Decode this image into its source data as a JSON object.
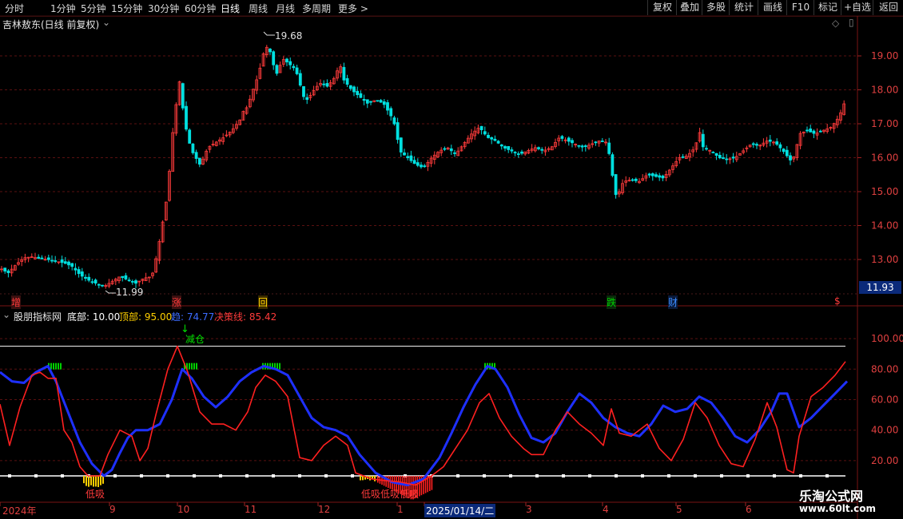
{
  "toolbar": {
    "periods": [
      "分时",
      "1分钟",
      "5分钟",
      "15分钟",
      "30分钟",
      "60分钟",
      "日线",
      "周线",
      "月线",
      "多周期",
      "更多 >"
    ],
    "selected": "日线",
    "right_buttons": [
      "复权",
      "叠加",
      "多股",
      "统计",
      "画线",
      "F10",
      "标记",
      "+自选",
      "返回"
    ]
  },
  "main_panel": {
    "title": "吉林敖东(日线 前复权)",
    "high_label": "19.68",
    "low_label": "11.99",
    "current_price": "11.93",
    "event_markers": [
      {
        "text": "增",
        "color": "#ff3b3b"
      },
      {
        "text": "涨",
        "color": "#ff3b3b"
      },
      {
        "text": "回",
        "color": "#ffd000"
      },
      {
        "text": "跌",
        "color": "#00d000"
      },
      {
        "text": "财",
        "color": "#3c8cff"
      },
      {
        "text": "$",
        "color": "#ff3b3b"
      }
    ]
  },
  "indicator_panel": {
    "name": "股朋指标网",
    "params": [
      {
        "label": "底部: 10.00",
        "color": "#ffffff"
      },
      {
        "label": "顶部: 95.00",
        "color": "#ffd000"
      },
      {
        "label": "趋: 74.77",
        "color": "#3c6cff"
      },
      {
        "label": "决策线: 85.42",
        "color": "#ff3b3b"
      }
    ],
    "annotations": {
      "reduce": "减仓",
      "buy_low_1": "低吸",
      "buy_low_2": "低吸低吸低吸"
    }
  },
  "x_axis": {
    "labels": [
      "2024年",
      "9",
      "10",
      "11",
      "12",
      "1",
      "2025/01/14/二",
      "3",
      "4",
      "5",
      "6"
    ]
  },
  "watermark": {
    "title": "乐淘公式网",
    "url": "www.60lt.com"
  },
  "colors": {
    "up": "#ff3b3b",
    "down": "#00e0e0",
    "trend": "#1e30ff",
    "decision": "#ff2020",
    "grid": "#5a1010"
  },
  "chart_data": [
    {
      "type": "candlestick",
      "title": "吉林敖东(日线 前复权)",
      "y_ticks": [
        13.0,
        14.0,
        15.0,
        16.0,
        17.0,
        18.0,
        19.0
      ],
      "ylim": [
        11.6,
        20.6
      ],
      "approx_close_path": [
        [
          0,
          12.75
        ],
        [
          10,
          12.6
        ],
        [
          20,
          12.85
        ],
        [
          30,
          13.05
        ],
        [
          40,
          13.08
        ],
        [
          50,
          13.02
        ],
        [
          60,
          13.0
        ],
        [
          70,
          12.95
        ],
        [
          80,
          12.9
        ],
        [
          90,
          12.8
        ],
        [
          100,
          12.55
        ],
        [
          110,
          12.4
        ],
        [
          120,
          12.3
        ],
        [
          130,
          12.2
        ],
        [
          140,
          12.35
        ],
        [
          150,
          12.5
        ],
        [
          160,
          12.4
        ],
        [
          170,
          12.3
        ],
        [
          180,
          12.45
        ],
        [
          190,
          12.5
        ],
        [
          195,
          13.0
        ],
        [
          200,
          13.6
        ],
        [
          205,
          14.3
        ],
        [
          210,
          15.0
        ],
        [
          215,
          16.5
        ],
        [
          220,
          17.5
        ],
        [
          225,
          18.3
        ],
        [
          230,
          17.2
        ],
        [
          235,
          16.6
        ],
        [
          240,
          16.2
        ],
        [
          245,
          16.0
        ],
        [
          250,
          15.8
        ],
        [
          255,
          16.0
        ],
        [
          260,
          16.3
        ],
        [
          270,
          16.45
        ],
        [
          280,
          16.6
        ],
        [
          290,
          16.8
        ],
        [
          300,
          17.1
        ],
        [
          305,
          17.4
        ],
        [
          310,
          17.5
        ],
        [
          315,
          17.9
        ],
        [
          320,
          18.2
        ],
        [
          325,
          18.6
        ],
        [
          330,
          19.1
        ],
        [
          335,
          19.3
        ],
        [
          340,
          19.0
        ],
        [
          345,
          18.4
        ],
        [
          350,
          18.7
        ],
        [
          355,
          18.9
        ],
        [
          360,
          18.8
        ],
        [
          365,
          18.7
        ],
        [
          370,
          18.6
        ],
        [
          375,
          18.2
        ],
        [
          380,
          17.8
        ],
        [
          385,
          17.7
        ],
        [
          390,
          17.9
        ],
        [
          400,
          18.2
        ],
        [
          410,
          18.1
        ],
        [
          420,
          18.4
        ],
        [
          425,
          18.8
        ],
        [
          430,
          18.3
        ],
        [
          440,
          18.0
        ],
        [
          450,
          17.8
        ],
        [
          460,
          17.6
        ],
        [
          470,
          17.7
        ],
        [
          480,
          17.6
        ],
        [
          490,
          17.2
        ],
        [
          495,
          16.9
        ],
        [
          500,
          16.2
        ],
        [
          510,
          16.0
        ],
        [
          520,
          15.8
        ],
        [
          530,
          15.7
        ],
        [
          540,
          16.0
        ],
        [
          550,
          16.2
        ],
        [
          560,
          16.3
        ],
        [
          570,
          16.1
        ],
        [
          580,
          16.4
        ],
        [
          590,
          16.7
        ],
        [
          600,
          16.9
        ],
        [
          610,
          16.6
        ],
        [
          620,
          16.5
        ],
        [
          630,
          16.3
        ],
        [
          640,
          16.2
        ],
        [
          650,
          16.1
        ],
        [
          660,
          16.2
        ],
        [
          670,
          16.3
        ],
        [
          680,
          16.2
        ],
        [
          690,
          16.3
        ],
        [
          700,
          16.6
        ],
        [
          710,
          16.5
        ],
        [
          720,
          16.4
        ],
        [
          730,
          16.3
        ],
        [
          740,
          16.4
        ],
        [
          750,
          16.5
        ],
        [
          760,
          16.45
        ],
        [
          765,
          15.7
        ],
        [
          770,
          14.9
        ],
        [
          775,
          15.0
        ],
        [
          780,
          15.3
        ],
        [
          790,
          15.35
        ],
        [
          800,
          15.3
        ],
        [
          810,
          15.5
        ],
        [
          820,
          15.45
        ],
        [
          830,
          15.4
        ],
        [
          840,
          15.7
        ],
        [
          850,
          16.0
        ],
        [
          860,
          16.05
        ],
        [
          870,
          16.3
        ],
        [
          875,
          16.8
        ],
        [
          880,
          16.3
        ],
        [
          890,
          16.2
        ],
        [
          900,
          16.0
        ],
        [
          910,
          15.95
        ],
        [
          920,
          16.0
        ],
        [
          930,
          16.2
        ],
        [
          940,
          16.4
        ],
        [
          950,
          16.35
        ],
        [
          960,
          16.5
        ],
        [
          970,
          16.45
        ],
        [
          980,
          16.2
        ],
        [
          990,
          15.9
        ],
        [
          995,
          16.1
        ],
        [
          1000,
          16.7
        ],
        [
          1010,
          16.8
        ],
        [
          1020,
          16.7
        ],
        [
          1030,
          16.8
        ],
        [
          1040,
          16.9
        ],
        [
          1050,
          17.2
        ],
        [
          1058,
          17.7
        ]
      ]
    },
    {
      "type": "line",
      "title": "股朋指标网",
      "y_ticks": [
        20.0,
        40.0,
        60.0,
        80.0,
        100.0
      ],
      "ylim": [
        0,
        115
      ],
      "reference_lines": [
        10.0,
        95.0
      ],
      "series": [
        {
          "name": "趋",
          "color": "#1e30ff",
          "points": [
            [
              0,
              78
            ],
            [
              15,
              72
            ],
            [
              30,
              71
            ],
            [
              45,
              78
            ],
            [
              60,
              82
            ],
            [
              70,
              72
            ],
            [
              85,
              52
            ],
            [
              100,
              32
            ],
            [
              115,
              18
            ],
            [
              130,
              10
            ],
            [
              140,
              14
            ],
            [
              150,
              25
            ],
            [
              160,
              35
            ],
            [
              170,
              40
            ],
            [
              185,
              40
            ],
            [
              200,
              44
            ],
            [
              215,
              60
            ],
            [
              228,
              80
            ],
            [
              240,
              74
            ],
            [
              255,
              62
            ],
            [
              270,
              55
            ],
            [
              285,
              62
            ],
            [
              300,
              72
            ],
            [
              315,
              78
            ],
            [
              330,
              82
            ],
            [
              345,
              80
            ],
            [
              360,
              76
            ],
            [
              375,
              62
            ],
            [
              390,
              48
            ],
            [
              405,
              42
            ],
            [
              420,
              40
            ],
            [
              435,
              36
            ],
            [
              450,
              24
            ],
            [
              470,
              12
            ],
            [
              490,
              6
            ],
            [
              510,
              4
            ],
            [
              530,
              8
            ],
            [
              550,
              22
            ],
            [
              565,
              38
            ],
            [
              580,
              55
            ],
            [
              595,
              70
            ],
            [
              610,
              82
            ],
            [
              620,
              80
            ],
            [
              635,
              68
            ],
            [
              650,
              50
            ],
            [
              665,
              35
            ],
            [
              680,
              32
            ],
            [
              695,
              38
            ],
            [
              710,
              52
            ],
            [
              725,
              64
            ],
            [
              740,
              58
            ],
            [
              755,
              48
            ],
            [
              770,
              42
            ],
            [
              785,
              38
            ],
            [
              800,
              36
            ],
            [
              815,
              44
            ],
            [
              830,
              56
            ],
            [
              845,
              52
            ],
            [
              860,
              54
            ],
            [
              875,
              62
            ],
            [
              890,
              58
            ],
            [
              905,
              48
            ],
            [
              920,
              36
            ],
            [
              935,
              32
            ],
            [
              950,
              40
            ],
            [
              965,
              52
            ],
            [
              975,
              64
            ],
            [
              985,
              64
            ],
            [
              1000,
              42
            ],
            [
              1015,
              48
            ],
            [
              1030,
              56
            ],
            [
              1045,
              64
            ],
            [
              1060,
              72
            ]
          ]
        },
        {
          "name": "决策线",
          "color": "#ff2020",
          "points": [
            [
              0,
              57
            ],
            [
              12,
              30
            ],
            [
              25,
              55
            ],
            [
              40,
              76
            ],
            [
              50,
              78
            ],
            [
              60,
              74
            ],
            [
              70,
              74
            ],
            [
              80,
              40
            ],
            [
              90,
              32
            ],
            [
              100,
              16
            ],
            [
              110,
              10
            ],
            [
              125,
              10
            ],
            [
              135,
              24
            ],
            [
              150,
              40
            ],
            [
              165,
              36
            ],
            [
              175,
              20
            ],
            [
              185,
              28
            ],
            [
              195,
              50
            ],
            [
              210,
              80
            ],
            [
              222,
              95
            ],
            [
              235,
              78
            ],
            [
              250,
              52
            ],
            [
              265,
              44
            ],
            [
              280,
              44
            ],
            [
              295,
              40
            ],
            [
              310,
              52
            ],
            [
              320,
              68
            ],
            [
              332,
              76
            ],
            [
              345,
              72
            ],
            [
              360,
              62
            ],
            [
              375,
              22
            ],
            [
              390,
              20
            ],
            [
              405,
              30
            ],
            [
              420,
              36
            ],
            [
              435,
              30
            ],
            [
              445,
              12
            ],
            [
              455,
              10
            ],
            [
              465,
              8
            ],
            [
              480,
              7
            ],
            [
              500,
              6
            ],
            [
              520,
              4
            ],
            [
              540,
              10
            ],
            [
              555,
              16
            ],
            [
              570,
              28
            ],
            [
              585,
              40
            ],
            [
              600,
              58
            ],
            [
              612,
              64
            ],
            [
              625,
              48
            ],
            [
              640,
              36
            ],
            [
              655,
              28
            ],
            [
              665,
              24
            ],
            [
              680,
              24
            ],
            [
              695,
              40
            ],
            [
              710,
              52
            ],
            [
              725,
              44
            ],
            [
              740,
              38
            ],
            [
              755,
              30
            ],
            [
              765,
              54
            ],
            [
              775,
              38
            ],
            [
              790,
              36
            ],
            [
              810,
              44
            ],
            [
              825,
              28
            ],
            [
              840,
              20
            ],
            [
              855,
              34
            ],
            [
              870,
              58
            ],
            [
              885,
              48
            ],
            [
              900,
              30
            ],
            [
              915,
              18
            ],
            [
              930,
              16
            ],
            [
              945,
              34
            ],
            [
              960,
              58
            ],
            [
              972,
              42
            ],
            [
              985,
              14
            ],
            [
              993,
              12
            ],
            [
              1000,
              36
            ],
            [
              1015,
              62
            ],
            [
              1030,
              68
            ],
            [
              1045,
              76
            ],
            [
              1058,
              85
            ]
          ]
        }
      ]
    }
  ]
}
